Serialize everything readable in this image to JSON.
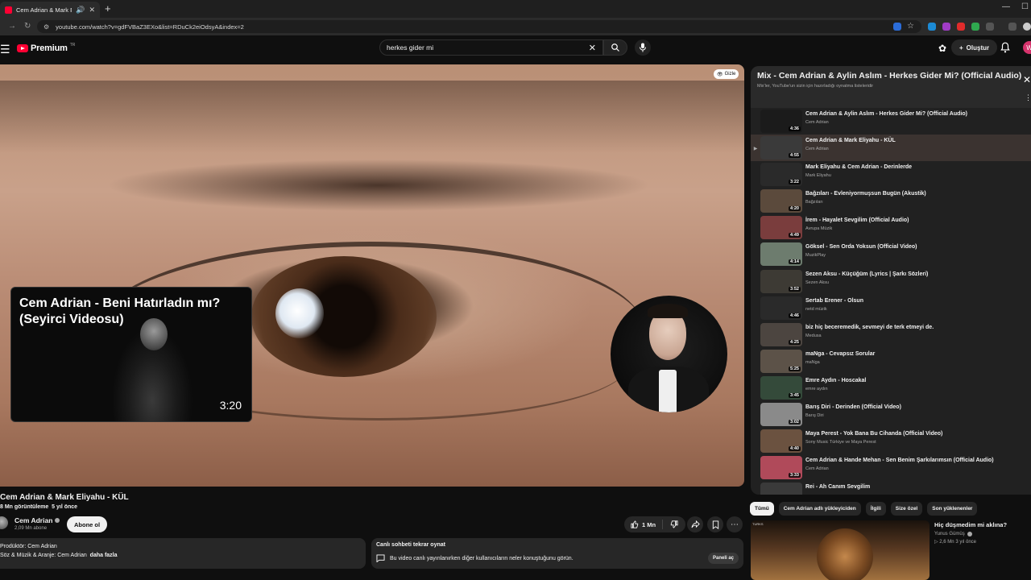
{
  "browser": {
    "tab_title": "Cem Adrian & Mark Eliyahu",
    "url": "youtube.com/watch?v=gdFVBaZ3EXo&list=RDuCk2eiOdsyA&index=2"
  },
  "masthead": {
    "logo_text": "Premium",
    "region": "TR",
    "search_query": "herkes gider mi",
    "create_label": "Oluştur",
    "avatar_letter": "W"
  },
  "player": {
    "hide_label": "Gizle",
    "endcard": {
      "title": "Cem Adrian - Beni Hatırladın mı? (Seyirci Videosu)",
      "duration": "3:20"
    }
  },
  "video": {
    "title": "Cem Adrian & Mark Eliyahu - KÜL",
    "views": "8 Mn görüntüleme",
    "age": "5 yıl önce",
    "channel": "Cem Adrian",
    "subscribers": "2,09 Mn abone",
    "subscribe_label": "Abone ol",
    "likes": "1 Mn",
    "description_line1": "Prodüktör: Cem Adrian",
    "description_line2": "Söz & Müzik & Aranje: Cem Adrian",
    "description_more": "daha fazla"
  },
  "chat_replay": {
    "title": "Canlı sohbeti tekrar oynat",
    "text": "Bu video canlı yayınlanırken diğer kullanıcıların neler konuştuğunu görün.",
    "open_label": "Paneli aç"
  },
  "playlist": {
    "title": "Mix - Cem Adrian & Aylin Aslım - Herkes Gider Mi? (Official Audio)",
    "subtitle": "Mix'ler, YouTube'un sizin için hazırladığı oynatma listeleridir",
    "items": [
      {
        "title": "Cem Adrian & Aylin Aslım - Herkes Gider Mi? (Official Audio)",
        "channel": "Cem Adrian",
        "duration": "4:36",
        "index": "",
        "color": "#1b1b1b"
      },
      {
        "title": "Cem Adrian & Mark Eliyahu - KÜL",
        "channel": "Cem Adrian",
        "duration": "4:55",
        "index": "▶",
        "color": "#3a3a3a"
      },
      {
        "title": "Mark Eliyahu & Cem Adrian - Derinlerde",
        "channel": "Mark Eliyahu",
        "duration": "3:22",
        "index": "",
        "color": "#2a2a2a"
      },
      {
        "title": "Bağzıları - Evleniyormuşsun Bugün (Akustik)",
        "channel": "Bağzıları",
        "duration": "4:20",
        "index": "",
        "color": "#5b4a3c"
      },
      {
        "title": "İrem - Hayalet Sevgilim (Official Audio)",
        "channel": "Avrupa Müzik",
        "duration": "4:49",
        "index": "",
        "color": "#7a3d3d"
      },
      {
        "title": "Göksel - Sen Orda Yoksun (Official Video)",
        "channel": "MuzikPlay",
        "duration": "4:14",
        "index": "",
        "color": "#6d7c6e"
      },
      {
        "title": "Sezen Aksu - Küçüğüm (Lyrics | Şarkı Sözleri)",
        "channel": "Sezen Aksu",
        "duration": "3:52",
        "index": "",
        "color": "#3d3a34"
      },
      {
        "title": "Sertab Erener - Olsun",
        "channel": "netd müzik",
        "duration": "4:46",
        "index": "",
        "color": "#2a2a2a"
      },
      {
        "title": "biz hiç beceremedik, sevmeyi de terk etmeyi de.",
        "channel": "Medusa",
        "duration": "4:25",
        "index": "",
        "color": "#4c4540"
      },
      {
        "title": "maNga - Cevapsız Sorular",
        "channel": "maNga",
        "duration": "5:25",
        "index": "",
        "color": "#5c5248"
      },
      {
        "title": "Emre Aydın - Hoscakal",
        "channel": "emre aydın",
        "duration": "3:45",
        "index": "",
        "color": "#344a3a"
      },
      {
        "title": "Barış Diri - Derinden (Official Video)",
        "channel": "Barış Diri",
        "duration": "3:02",
        "index": "",
        "color": "#8a8a8a"
      },
      {
        "title": "Maya Perest - Yok Bana Bu Cihanda (Official Video)",
        "channel": "Sony Music Türkiye ve Maya Perest",
        "duration": "4:40",
        "index": "",
        "color": "#6b5240"
      },
      {
        "title": "Cem Adrian & Hande Mehan - Sen Benim Şarkılarımsın (Official Audio)",
        "channel": "Cem Adrian",
        "duration": "3:33",
        "index": "",
        "color": "#b04a5a"
      },
      {
        "title": "Rei - Ah Canım Sevgilim",
        "channel": "",
        "duration": "",
        "index": "",
        "color": "#3a3a3a"
      }
    ]
  },
  "chips": [
    "Tümü",
    "Cem Adrian adlı yükleyiciden",
    "İlgili",
    "Size özel",
    "Son yüklenenler"
  ],
  "recommendation": {
    "thumb_label": "TURKS",
    "title": "Hiç düşmedim mi aklına?",
    "channel": "Yunus Gümüş",
    "views": "2,6 Mn",
    "age": "3 yıl önce"
  }
}
